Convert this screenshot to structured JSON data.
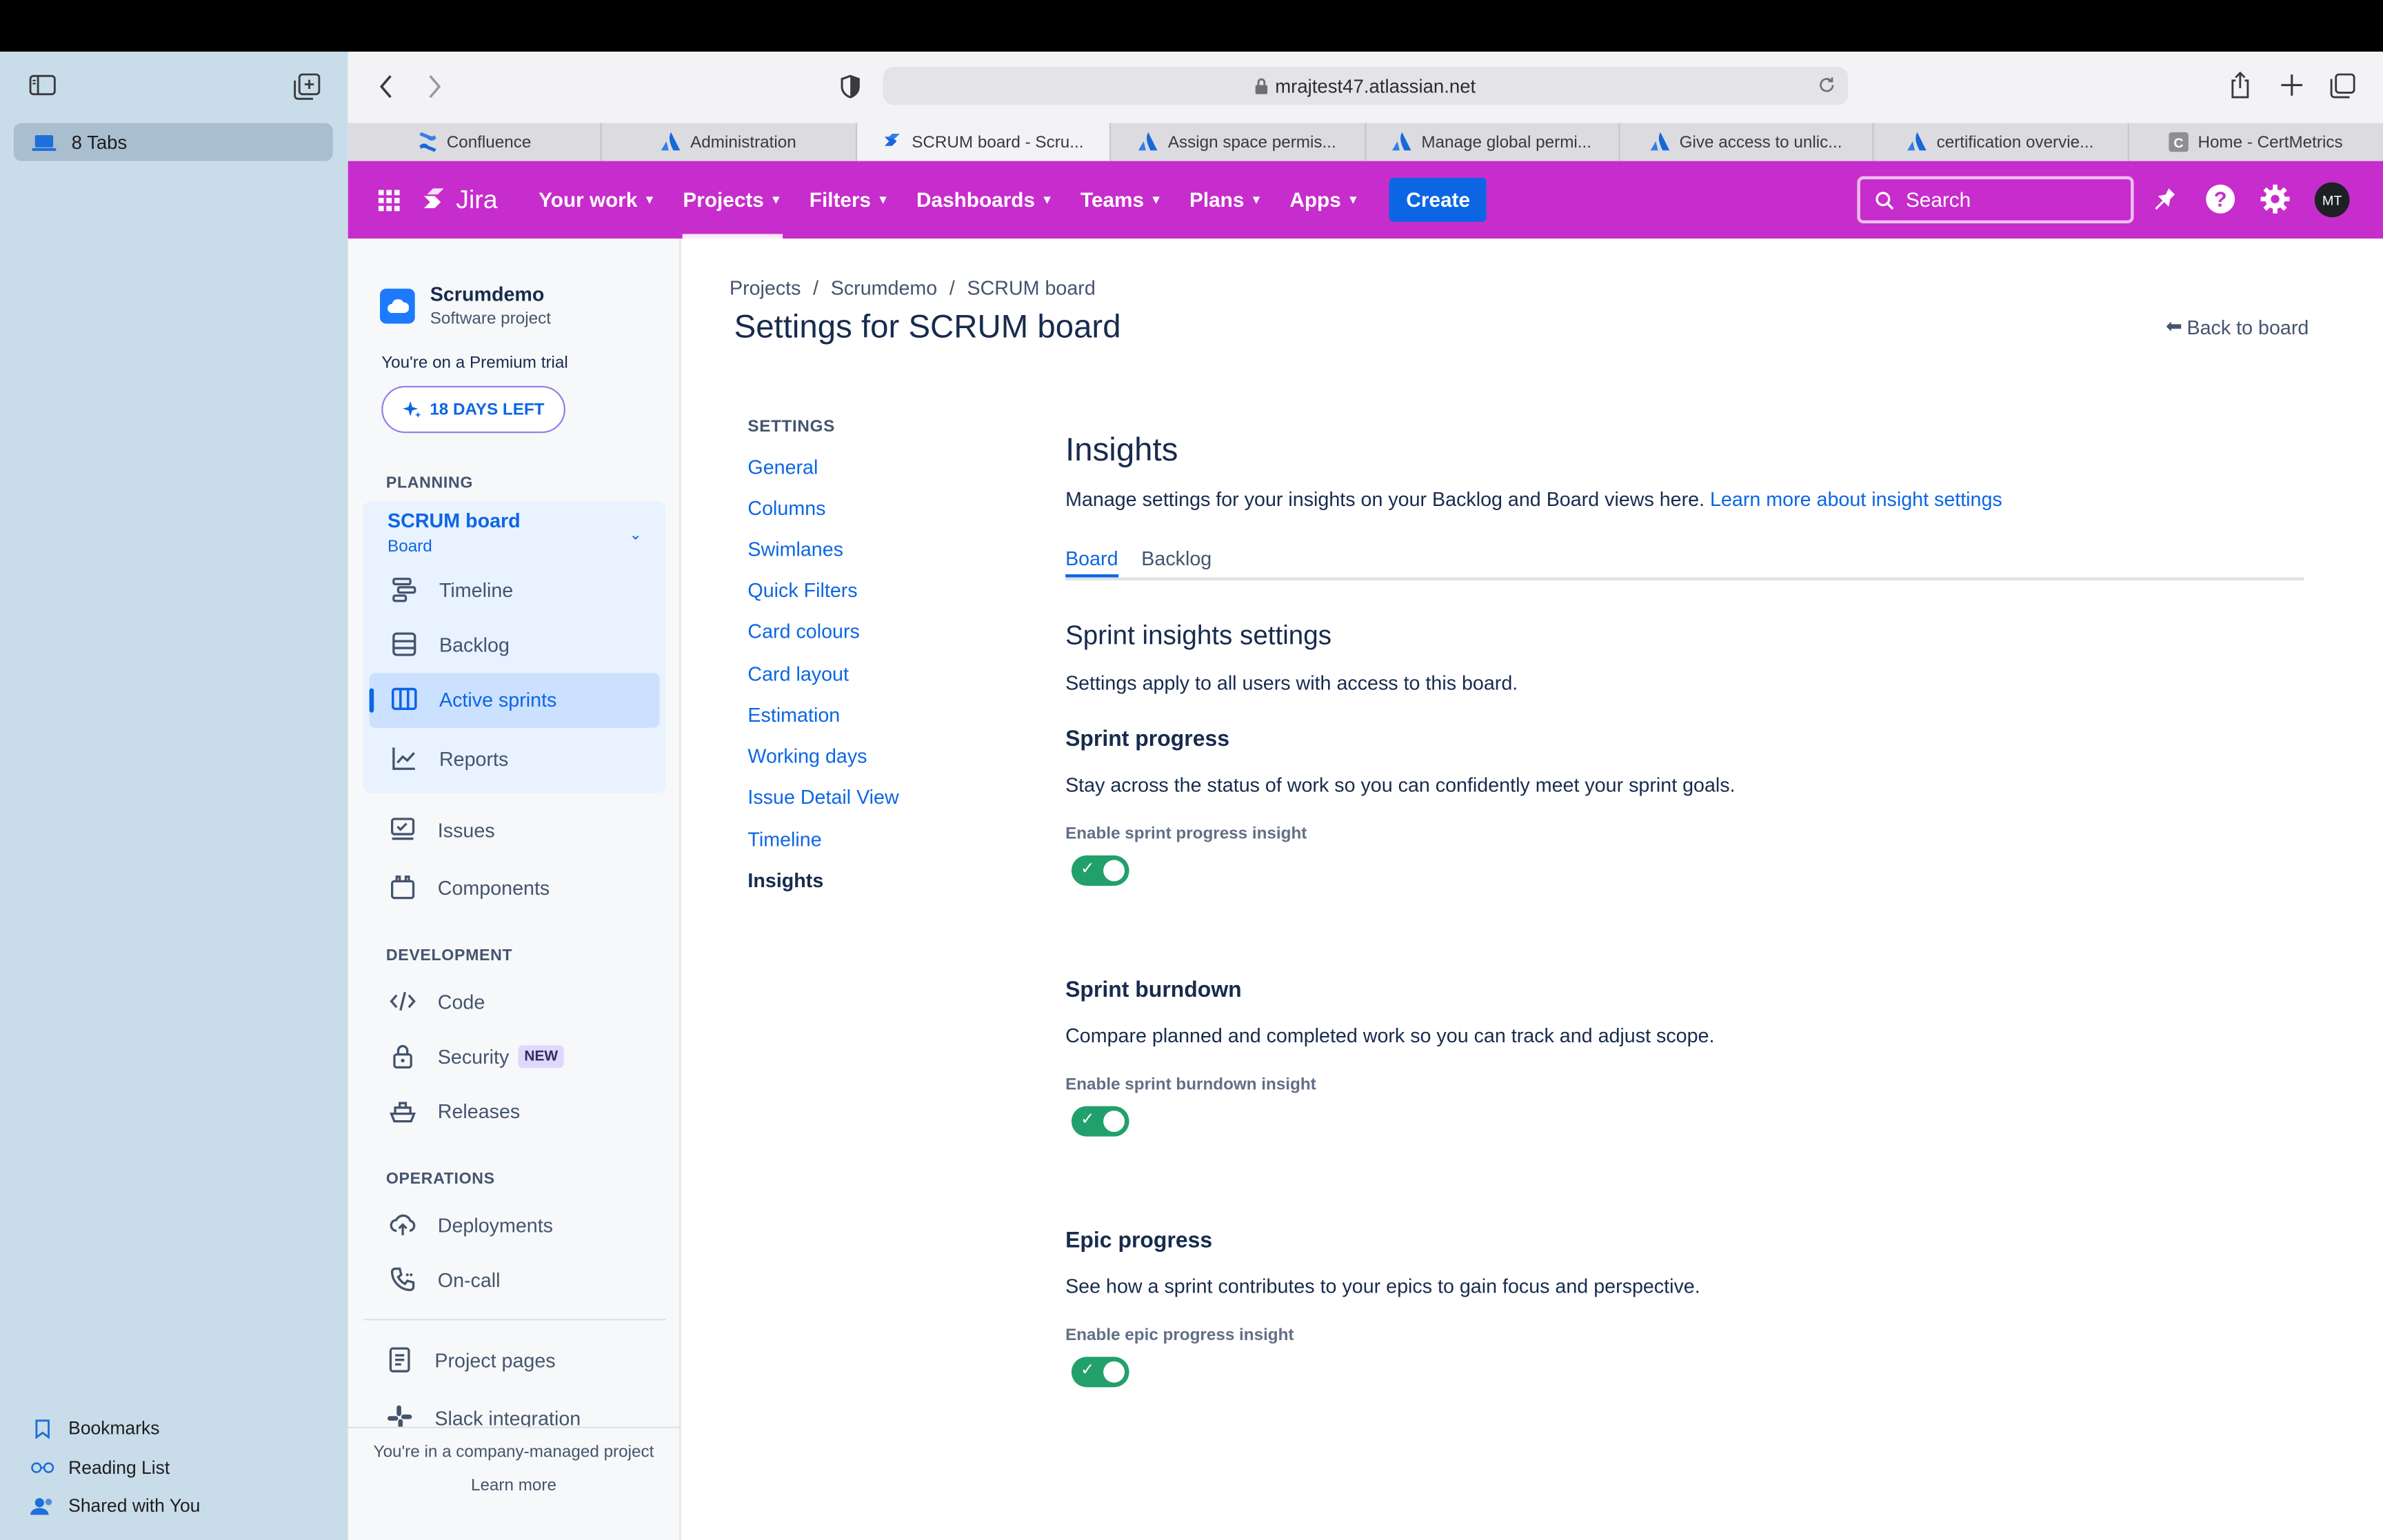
{
  "safari": {
    "tab_group_label": "8 Tabs",
    "url": "mrajtest47.atlassian.net",
    "footer": {
      "bookmarks": "Bookmarks",
      "reading_list": "Reading List",
      "shared": "Shared with You"
    },
    "tabs": [
      {
        "label": "Confluence",
        "icon": "confluence-icon"
      },
      {
        "label": "Administration",
        "icon": "atlassian-icon"
      },
      {
        "label": "SCRUM board - Scru...",
        "icon": "jira-icon",
        "active": true
      },
      {
        "label": "Assign space permis...",
        "icon": "atlassian-icon"
      },
      {
        "label": "Manage global permi...",
        "icon": "atlassian-icon"
      },
      {
        "label": "Give access to unlic...",
        "icon": "atlassian-icon"
      },
      {
        "label": "certification overvie...",
        "icon": "atlassian-icon"
      },
      {
        "label": "Home - CertMetrics",
        "icon": "certmetrics-icon"
      }
    ]
  },
  "jira_nav": {
    "logo": "Jira",
    "items": [
      "Your work",
      "Projects",
      "Filters",
      "Dashboards",
      "Teams",
      "Plans",
      "Apps"
    ],
    "create": "Create",
    "search_placeholder": "Search",
    "avatar": "MT",
    "brand_color": "#c72ccc"
  },
  "project_sidebar": {
    "project_name": "Scrumdemo",
    "project_type": "Software project",
    "trial_text": "You're on a Premium trial",
    "trial_button": "18 DAYS LEFT",
    "planning_heading": "PLANNING",
    "board_name": "SCRUM board",
    "board_sub": "Board",
    "board_items": [
      "Timeline",
      "Backlog",
      "Active sprints",
      "Reports"
    ],
    "items": [
      "Issues",
      "Components"
    ],
    "development_heading": "DEVELOPMENT",
    "dev_items": [
      "Code",
      "Security",
      "Releases"
    ],
    "new_badge": "NEW",
    "operations_heading": "OPERATIONS",
    "ops_items": [
      "Deployments",
      "On-call"
    ],
    "extra_items": [
      "Project pages",
      "Slack integration"
    ],
    "footer_text": "You're in a company-managed project",
    "footer_link": "Learn more"
  },
  "main": {
    "breadcrumb": [
      "Projects",
      "Scrumdemo",
      "SCRUM board"
    ],
    "title": "Settings for SCRUM board",
    "back": "Back to board",
    "settings_heading": "SETTINGS",
    "settings_nav": [
      "General",
      "Columns",
      "Swimlanes",
      "Quick Filters",
      "Card colours",
      "Card layout",
      "Estimation",
      "Working days",
      "Issue Detail View",
      "Timeline",
      "Insights"
    ],
    "insights": {
      "heading": "Insights",
      "desc": "Manage settings for your insights on your Backlog and Board views here.",
      "learn_more": "Learn more about insight settings",
      "tabs": [
        "Board",
        "Backlog"
      ],
      "section_heading": "Sprint insights settings",
      "section_desc": "Settings apply to all users with access to this board.",
      "groups": [
        {
          "title": "Sprint progress",
          "desc": "Stay across the status of work so you can confidently meet your sprint goals.",
          "toggle_label": "Enable sprint progress insight",
          "enabled": true
        },
        {
          "title": "Sprint burndown",
          "desc": "Compare planned and completed work so you can track and adjust scope.",
          "toggle_label": "Enable sprint burndown insight",
          "enabled": true
        },
        {
          "title": "Epic progress",
          "desc": "See how a sprint contributes to your epics to gain focus and perspective.",
          "toggle_label": "Enable epic progress insight",
          "enabled": true
        }
      ]
    }
  }
}
